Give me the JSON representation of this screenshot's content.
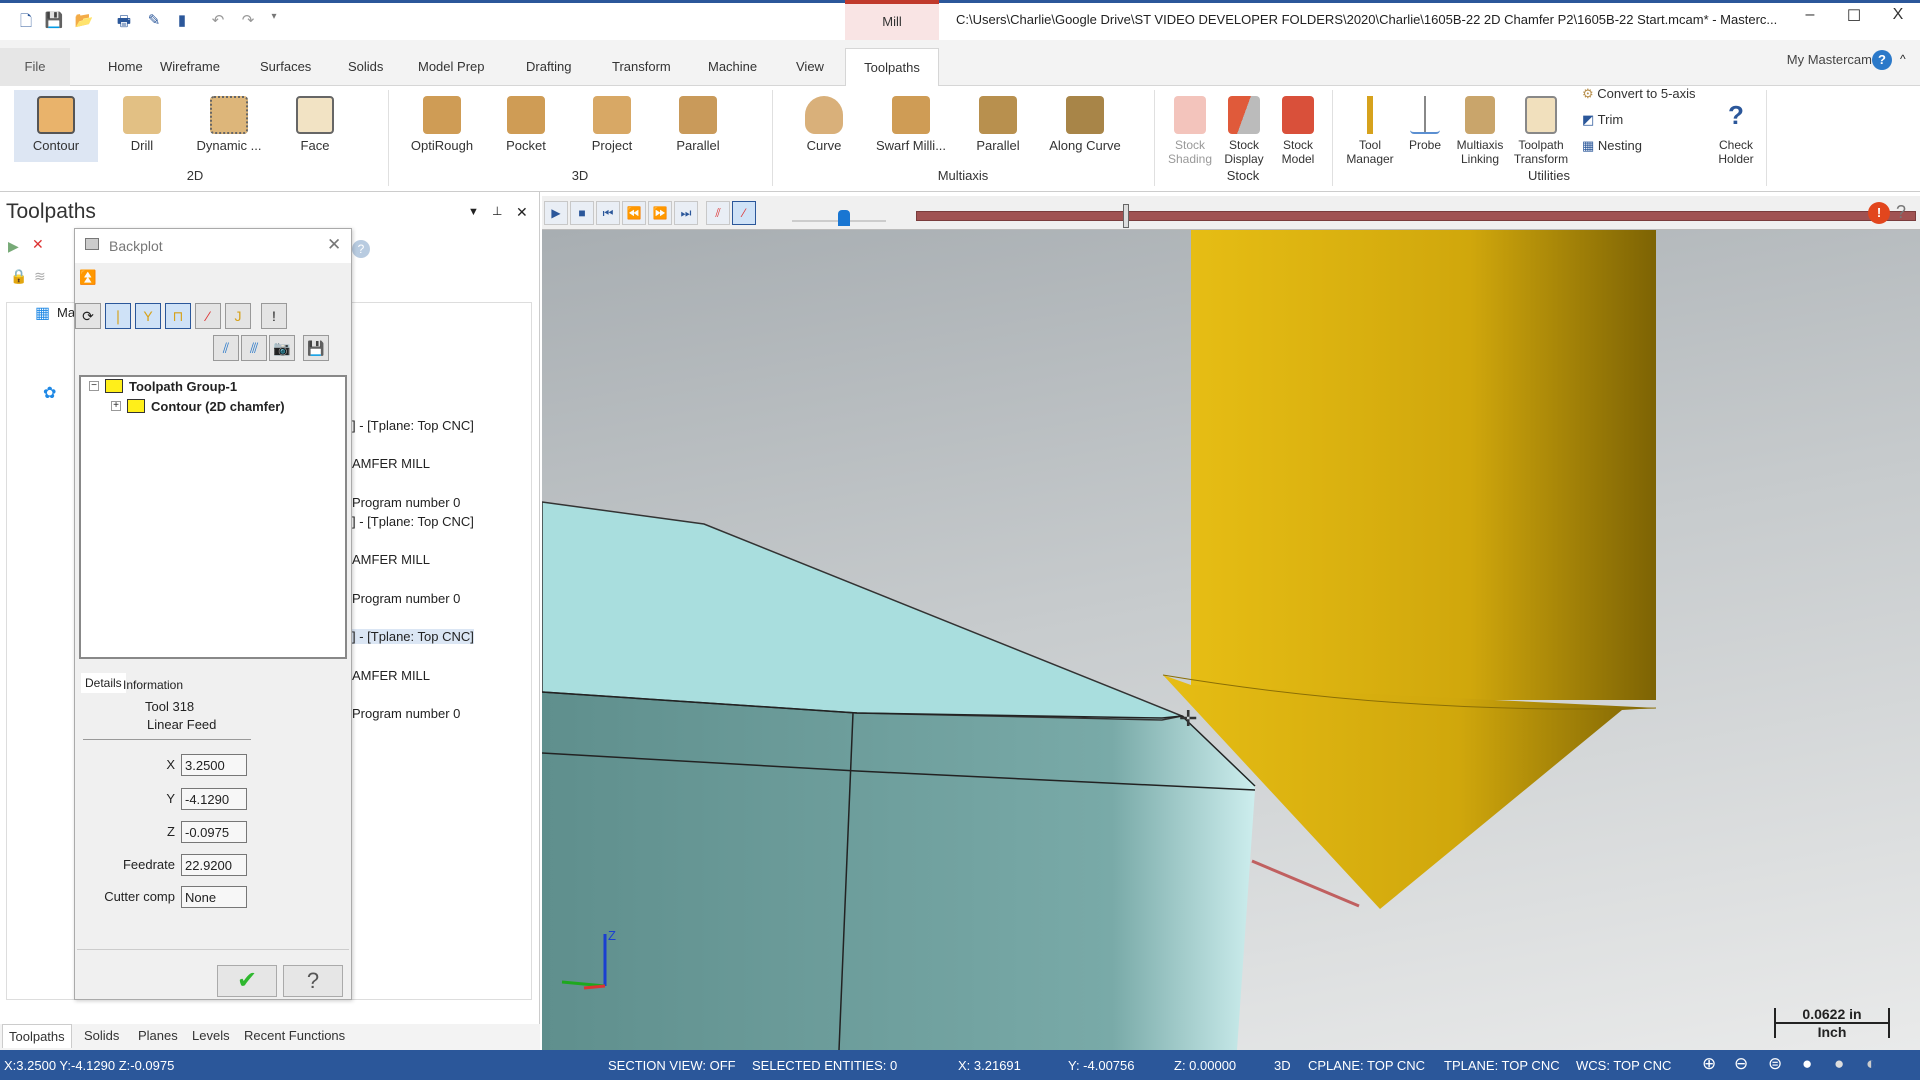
{
  "titlebar": {
    "context_tab": "Mill",
    "title": "C:\\Users\\Charlie\\Google Drive\\ST VIDEO DEVELOPER FOLDERS\\2020\\Charlie\\1605B-22 2D Chamfer P2\\1605B-22 Start.mcam* - Masterc...",
    "minimize": "–",
    "maximize": "☐",
    "close": "X"
  },
  "tabs": [
    "File",
    "Home",
    "Wireframe",
    "Surfaces",
    "Solids",
    "Model Prep",
    "Drafting",
    "Transform",
    "Machine",
    "View",
    "Toolpaths"
  ],
  "active_tab": "Toolpaths",
  "my_mastercam": "My Mastercam",
  "ribbon": {
    "groups": [
      {
        "label": "2D",
        "buttons": [
          "Contour",
          "Drill",
          "Dynamic ...",
          "Face"
        ]
      },
      {
        "label": "3D",
        "buttons": [
          "OptiRough",
          "Pocket",
          "Project",
          "Parallel"
        ]
      },
      {
        "label": "Multiaxis",
        "buttons": [
          "Curve",
          "Swarf Milli...",
          "Parallel",
          "Along Curve"
        ]
      },
      {
        "label": "Stock",
        "buttons": [
          "Stock Shading",
          "Stock Display",
          "Stock Model"
        ]
      },
      {
        "label": "Utilities",
        "buttons": [
          "Tool Manager",
          "Probe",
          "Multiaxis Linking",
          "Toolpath Transform",
          "Check Holder"
        ],
        "small": [
          "Convert to 5-axis",
          "Trim",
          "Nesting"
        ]
      }
    ],
    "icon_color": "#d9a95b",
    "selected": "Contour"
  },
  "toolpaths_panel": {
    "title": "Toolpaths",
    "tree_lines": [
      "Ma",
      "] - [Tplane: Top CNC]",
      "AMFER MILL",
      "Program number 0",
      "] - [Tplane: Top CNC]",
      "AMFER MILL",
      "Program number 0",
      "] - [Tplane: Top CNC]",
      "AMFER MILL",
      "Program number 0"
    ],
    "bottom_tabs": [
      "Toolpaths",
      "Solids",
      "Planes",
      "Levels",
      "Recent Functions"
    ]
  },
  "backplot": {
    "title": "Backplot",
    "tree": {
      "group": "Toolpath Group-1",
      "operation": "Contour (2D chamfer)"
    },
    "tabs": [
      "Details",
      "Information"
    ],
    "tool": "Tool 318",
    "motion": "Linear Feed",
    "fields": [
      {
        "label": "X",
        "value": "3.2500"
      },
      {
        "label": "Y",
        "value": "-4.1290"
      },
      {
        "label": "Z",
        "value": "-0.0975"
      },
      {
        "label": "Feedrate",
        "value": "22.9200"
      },
      {
        "label": "Cutter comp",
        "value": "None"
      }
    ],
    "ok": "✔",
    "help": "?"
  },
  "playback": {
    "progress_percent": 21,
    "speed_percent": 55
  },
  "viewport": {
    "scale_value": "0.0622 in",
    "scale_unit": "Inch",
    "axis_z": "Z",
    "colors": {
      "tool": "#d4aa10",
      "part_top": "#a8dcdc",
      "part_side": "#6a9c9a",
      "path": "#c06060"
    }
  },
  "statusbar": {
    "left": "X:3.2500  Y:-4.1290  Z:-0.0975",
    "section": "SECTION VIEW: OFF",
    "selected": "SELECTED ENTITIES: 0",
    "x": "X:  3.21691",
    "y": "Y:  -4.00756",
    "z": "Z:  0.00000",
    "mode": "3D",
    "cplane": "CPLANE: TOP CNC",
    "tplane": "TPLANE: TOP CNC",
    "wcs": "WCS: TOP CNC"
  }
}
